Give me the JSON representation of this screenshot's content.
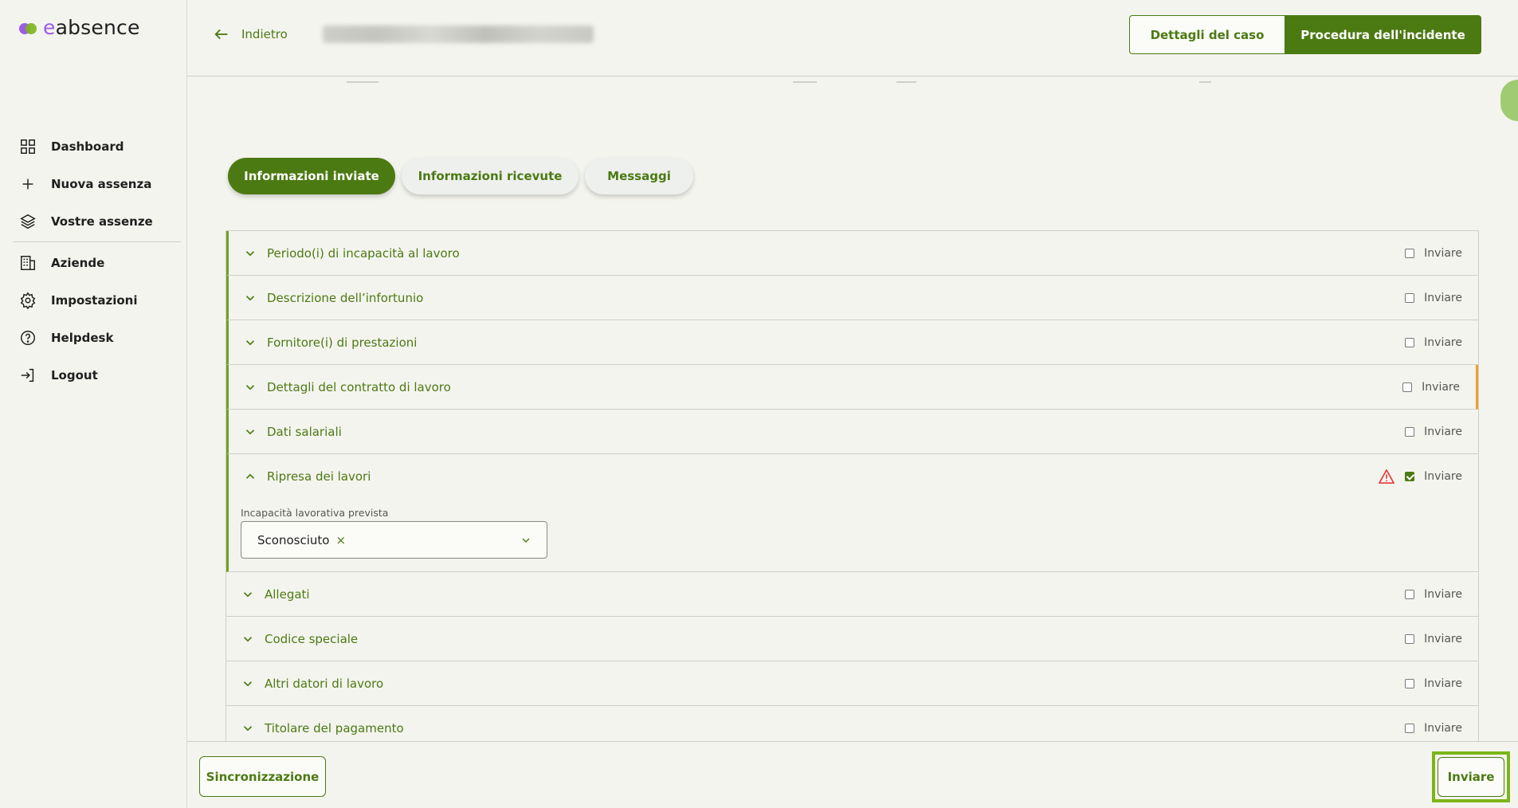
{
  "app": {
    "logo_prefix": "e",
    "logo_suffix": "absence",
    "brand_color": "#4c7a12",
    "accent_color": "#7cb518"
  },
  "sidebar": {
    "items": [
      {
        "label": "Dashboard",
        "icon": "grid-icon"
      },
      {
        "label": "Nuova assenza",
        "icon": "plus-icon"
      },
      {
        "label": "Vostre assenze",
        "icon": "layers-icon"
      },
      {
        "label": "Aziende",
        "icon": "building-icon"
      },
      {
        "label": "Impostazioni",
        "icon": "gear-icon"
      },
      {
        "label": "Helpdesk",
        "icon": "help-circle-icon"
      },
      {
        "label": "Logout",
        "icon": "logout-icon"
      }
    ]
  },
  "header": {
    "back_label": "Indietro",
    "tabs": [
      {
        "label": "Dettagli del caso",
        "active": false
      },
      {
        "label": "Procedura dell'incidente",
        "active": true
      }
    ]
  },
  "subtabs": [
    {
      "label": "Informazioni inviate",
      "active": true
    },
    {
      "label": "Informazioni ricevute",
      "active": false
    },
    {
      "label": "Messaggi",
      "active": false
    }
  ],
  "sections": [
    {
      "title": "Periodo(i) di incapacità al lavoro",
      "checked": false
    },
    {
      "title": "Descrizione dell’infortunio",
      "checked": false
    },
    {
      "title": "Fornitore(i) di prestazioni",
      "checked": false
    },
    {
      "title": "Dettagli del contratto di lavoro",
      "checked": false
    },
    {
      "title": "Dati salariali",
      "checked": false
    },
    {
      "title": "Ripresa dei lavori",
      "checked": true,
      "expanded": true,
      "warning": true,
      "field_label": "Incapacità lavorativa prevista",
      "field_value": "Sconosciuto",
      "clear_symbol": "×"
    },
    {
      "title": "Allegati",
      "checked": false
    },
    {
      "title": "Codice speciale",
      "checked": false
    },
    {
      "title": "Altri datori di lavoro",
      "checked": false
    },
    {
      "title": "Titolare del pagamento",
      "checked": false
    }
  ],
  "send_checkbox_label": "Inviare",
  "footer": {
    "sync_label": "Sincronizzazione",
    "send_label": "Inviare"
  }
}
